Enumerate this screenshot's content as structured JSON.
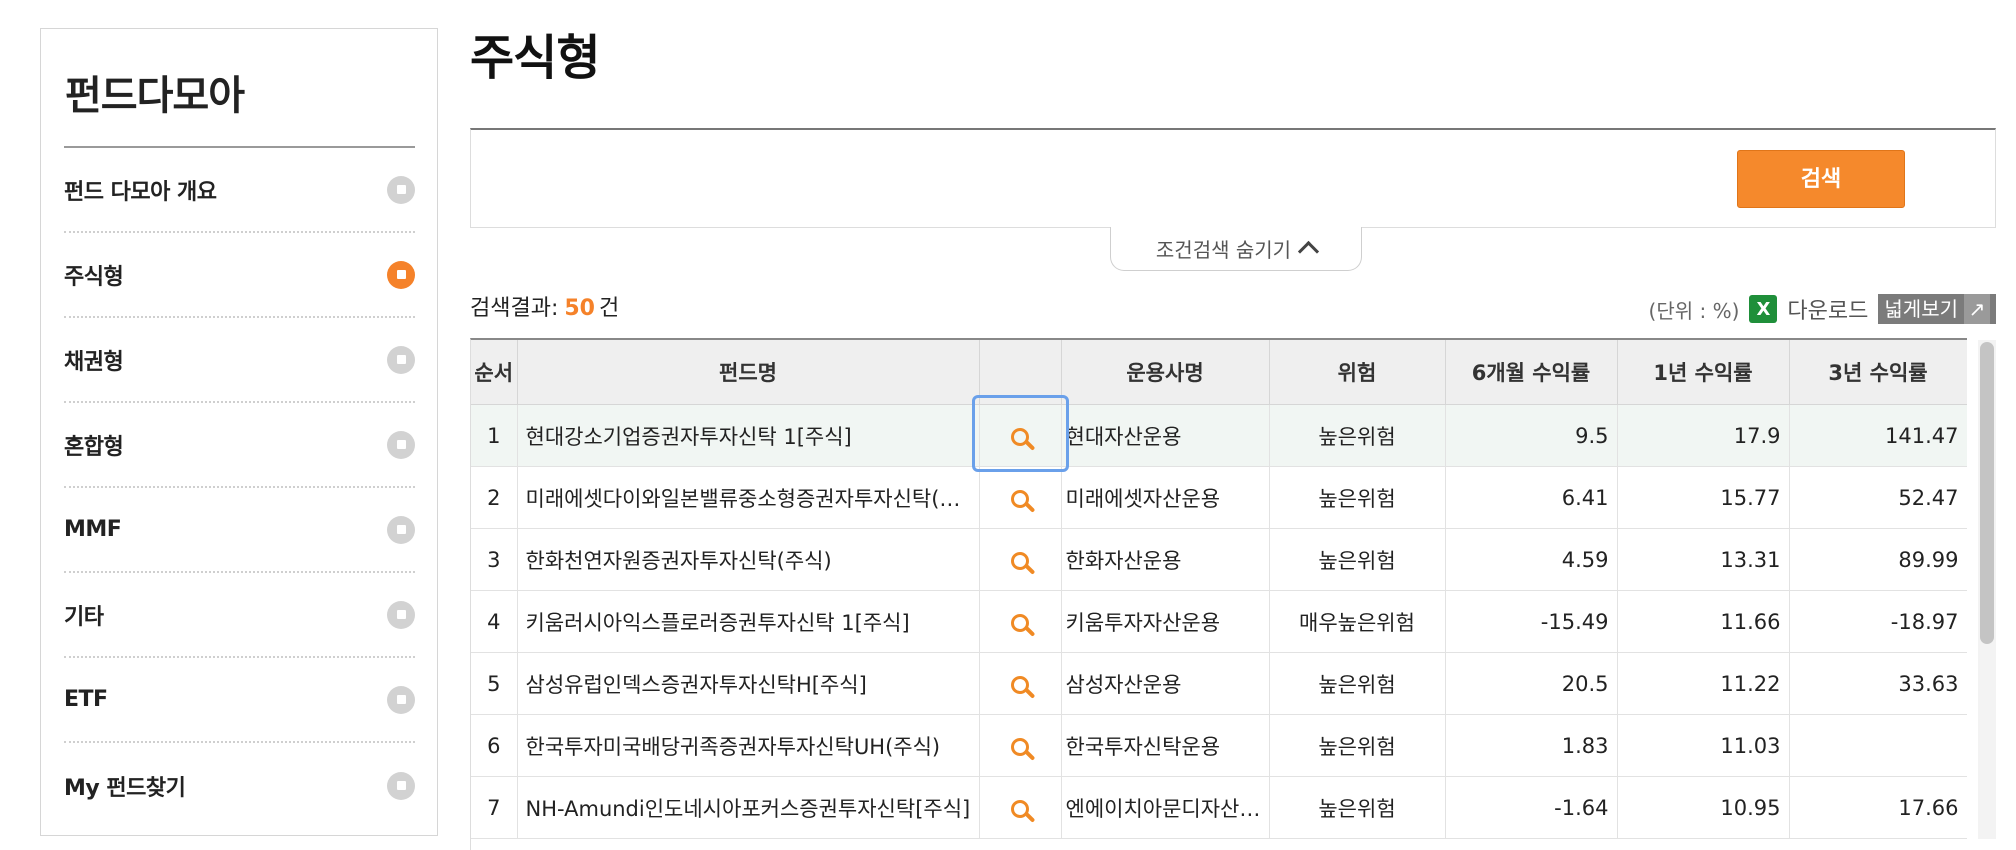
{
  "sidebar": {
    "title": "펀드다모아",
    "items": [
      {
        "label": "펀드 다모아 개요",
        "active": false
      },
      {
        "label": "주식형",
        "active": true
      },
      {
        "label": "채권형",
        "active": false
      },
      {
        "label": "혼합형",
        "active": false
      },
      {
        "label": "MMF",
        "active": false
      },
      {
        "label": "기타",
        "active": false
      },
      {
        "label": "ETF",
        "active": false
      },
      {
        "label": "My 펀드찾기",
        "active": false
      }
    ]
  },
  "main": {
    "page_title": "주식형",
    "search_button": "검색",
    "toggle_label": "조건검색 숨기기",
    "result_label": "검색결과:",
    "result_count": "50",
    "result_unit": "건",
    "unit_label": "(단위 : %)",
    "excel_glyph": "X",
    "download_label": "다운로드",
    "wide_view_label": "넓게보기",
    "wide_view_arrow": "↗"
  },
  "table": {
    "headers": [
      "순서",
      "펀드명",
      "",
      "운용사명",
      "위험",
      "6개월 수익률",
      "1년 수익률",
      "3년 수익률"
    ],
    "rows": [
      {
        "no": "1",
        "name": "현대강소기업증권자투자신탁 1[주식]",
        "company": "현대자산운용",
        "risk": "높은위험",
        "r6m": "9.5",
        "r1y": "17.9",
        "r3y": "141.47"
      },
      {
        "no": "2",
        "name": "미래에셋다이와일본밸류중소형증권자투자신탁(주식)",
        "company": "미래에셋자산운용",
        "risk": "높은위험",
        "r6m": "6.41",
        "r1y": "15.77",
        "r3y": "52.47"
      },
      {
        "no": "3",
        "name": "한화천연자원증권자투자신탁(주식)",
        "company": "한화자산운용",
        "risk": "높은위험",
        "r6m": "4.59",
        "r1y": "13.31",
        "r3y": "89.99"
      },
      {
        "no": "4",
        "name": "키움러시아익스플로러증권투자신탁 1[주식]",
        "company": "키움투자자산운용",
        "risk": "매우높은위험",
        "r6m": "-15.49",
        "r1y": "11.66",
        "r3y": "-18.97"
      },
      {
        "no": "5",
        "name": "삼성유럽인덱스증권자투자신탁H[주식]",
        "company": "삼성자산운용",
        "risk": "높은위험",
        "r6m": "20.5",
        "r1y": "11.22",
        "r3y": "33.63"
      },
      {
        "no": "6",
        "name": "한국투자미국배당귀족증권자투자신탁UH(주식)",
        "company": "한국투자신탁운용",
        "risk": "높은위험",
        "r6m": "1.83",
        "r1y": "11.03",
        "r3y": ""
      },
      {
        "no": "7",
        "name": "NH-Amundi인도네시아포커스증권투자신탁[주식]",
        "company": "엔에이치아문디자산운용",
        "risk": "높은위험",
        "r6m": "-1.64",
        "r1y": "10.95",
        "r3y": "17.66"
      }
    ]
  },
  "colors": {
    "accent": "#f5822a",
    "focus": "#6aa0ea",
    "excel": "#1f8f3a"
  }
}
